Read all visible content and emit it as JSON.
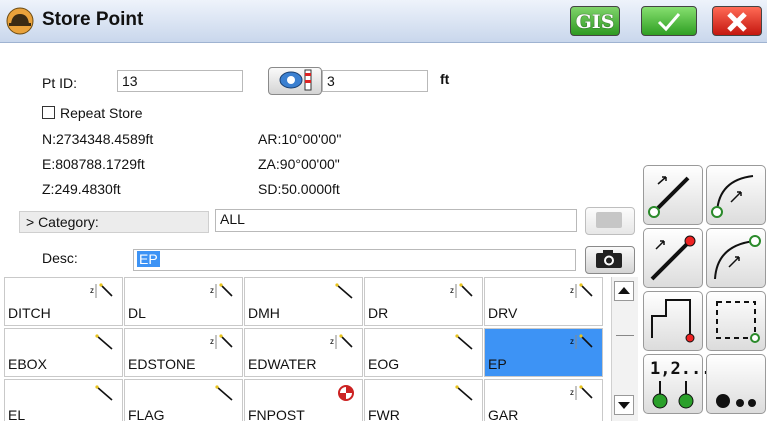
{
  "window": {
    "title": "Store Point"
  },
  "toolbar": {
    "gis_label": "GIS",
    "ok_icon": "check-icon",
    "cancel_icon": "close-icon"
  },
  "form": {
    "pt_id_label": "Pt ID:",
    "pt_id_value": "13",
    "height_value": "3",
    "height_unit": "ft",
    "repeat_store_label": "Repeat Store",
    "repeat_store_checked": false,
    "category_button": "> Category:",
    "category_value": "ALL",
    "desc_label": "Desc:",
    "desc_value": "EP"
  },
  "readouts": {
    "north": "N:2734348.4589ft",
    "east": "E:808788.1729ft",
    "elev": "Z:249.4830ft",
    "ar": "AR:10°00'00\"",
    "za": "ZA:90°00'00\"",
    "sd": "SD:50.0000ft"
  },
  "tools": [
    {
      "name": "line-start-tool",
      "icon": "line-point-icon"
    },
    {
      "name": "arc-start-tool",
      "icon": "arc-point-icon"
    },
    {
      "name": "line-end-tool",
      "icon": "line-end-icon"
    },
    {
      "name": "arc-end-tool",
      "icon": "arc-end-icon"
    },
    {
      "name": "polygon-close-tool",
      "icon": "polygon-close-icon"
    },
    {
      "name": "rectangle-tool",
      "icon": "rectangle-icon"
    },
    {
      "name": "number-points-tool",
      "icon": "numbered-points-icon",
      "label": "1,2..."
    },
    {
      "name": "more-tool",
      "icon": "more-dots-icon"
    }
  ],
  "codes": {
    "rows": [
      [
        {
          "label": "DITCH",
          "icon": "z-line-icon"
        },
        {
          "label": "DL",
          "icon": "z-line-icon"
        },
        {
          "label": "DMH",
          "icon": "line-icon"
        },
        {
          "label": "DR",
          "icon": "z-line-icon"
        },
        {
          "label": "DRV",
          "icon": "z-line-icon"
        }
      ],
      [
        {
          "label": "EBOX",
          "icon": "line-icon"
        },
        {
          "label": "EDSTONE",
          "icon": "z-line-icon"
        },
        {
          "label": "EDWATER",
          "icon": "z-line-icon"
        },
        {
          "label": "EOG",
          "icon": "line-icon"
        },
        {
          "label": "EP",
          "icon": "z-line-icon",
          "selected": true
        }
      ],
      [
        {
          "label": "EL",
          "icon": "line-icon"
        },
        {
          "label": "FLAG",
          "icon": "line-icon"
        },
        {
          "label": "FNPOST",
          "icon": "target-icon"
        },
        {
          "label": "FWR",
          "icon": "line-icon"
        },
        {
          "label": "GAR",
          "icon": "z-line-icon"
        }
      ]
    ]
  },
  "colors": {
    "selected": "#3d93f5",
    "titlebar": "#c9d7ec"
  }
}
